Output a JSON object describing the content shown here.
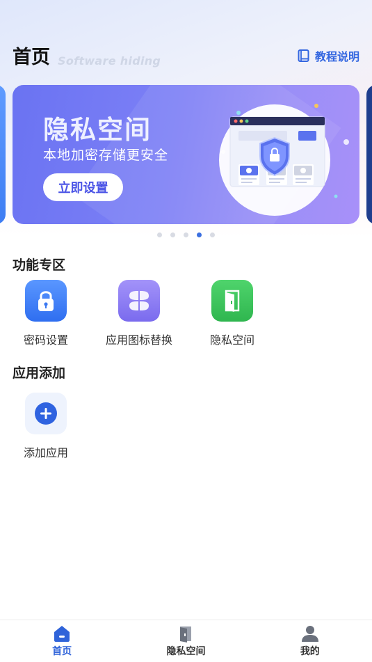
{
  "header": {
    "title": "首页",
    "subtitle": "Software hiding",
    "tutorial_label": "教程说明"
  },
  "banner": {
    "title": "隐私空间",
    "subtitle": "本地加密存储更安全",
    "button_label": "立即设置",
    "total_slides": 5,
    "active_slide": 4
  },
  "features": {
    "title": "功能专区",
    "items": [
      {
        "label": "密码设置",
        "icon": "lock-icon",
        "color": "#3f7df3"
      },
      {
        "label": "应用图标替换",
        "icon": "four-petal-icon",
        "color": "#8a7cf2"
      },
      {
        "label": "隐私空间",
        "icon": "door-icon",
        "color": "#3cc45e"
      }
    ]
  },
  "apps": {
    "title": "应用添加",
    "add_label": "添加应用"
  },
  "tabbar": {
    "items": [
      {
        "label": "首页",
        "icon": "home-icon",
        "active": true
      },
      {
        "label": "隐私空间",
        "icon": "door-icon",
        "active": false
      },
      {
        "label": "我的",
        "icon": "user-icon",
        "active": false
      }
    ]
  },
  "colors": {
    "accent": "#2f63d9",
    "banner_start": "#6a73f2",
    "banner_end": "#a890f9"
  }
}
